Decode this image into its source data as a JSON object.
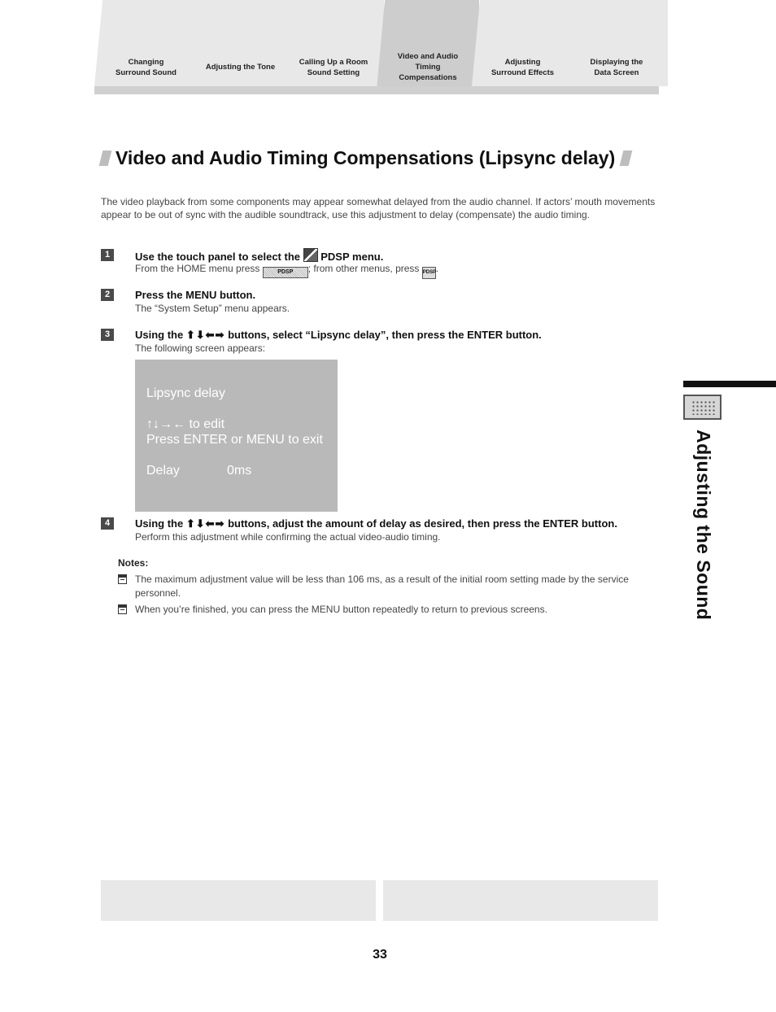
{
  "tabs": [
    {
      "label": "Changing Surround Sound",
      "lines": [
        "Changing",
        "Surround Sound"
      ],
      "active": false
    },
    {
      "label": "Adjusting the Tone",
      "lines": [
        "Adjusting the Tone"
      ],
      "active": false
    },
    {
      "label": "Calling Up a Room Sound Setting",
      "lines": [
        "Calling Up a Room",
        "Sound Setting"
      ],
      "active": false
    },
    {
      "label": "Video and Audio Timing Compensations",
      "lines": [
        "Video and Audio",
        "Timing",
        "Compensations"
      ],
      "active": true
    },
    {
      "label": "Adjusting Surround Effects",
      "lines": [
        "Adjusting",
        "Surround Effects"
      ],
      "active": false
    },
    {
      "label": "Displaying the Data Screen",
      "lines": [
        "Displaying the",
        "Data Screen"
      ],
      "active": false
    }
  ],
  "title": "Video and Audio Timing Compensations (Lipsync delay)",
  "intro": "The video playback from some components may appear somewhat delayed from the audio channel. If actors’ mouth movements appear to be out of sync with the audible soundtrack, use this adjustment to delay (compensate) the audio timing.",
  "steps": [
    {
      "number": "1",
      "head_pre": "Use the touch panel to select the",
      "head_icon": "pdsp-menu-icon",
      "head_post": "PDSP menu.",
      "sub_pre": "From the HOME menu press",
      "sub_key_wide": "PDSP",
      "sub_mid": "; from other menus, press",
      "sub_key_small": "PDSP",
      "sub_post": "."
    },
    {
      "number": "2",
      "head": "Press the MENU button.",
      "sub": "The “System Setup” menu appears."
    },
    {
      "number": "3",
      "head_pre": "Using the",
      "arrows": "⬆⬇⬅➡",
      "head_post": "buttons, select “Lipsync delay”, then press the ENTER button.",
      "sub": "The following screen appears:"
    },
    {
      "number": "4",
      "head_pre": "Using the",
      "arrows": "⬆⬇⬅➡",
      "head_post": "buttons, adjust the amount of delay as desired, then press the ENTER button.",
      "sub": "Perform this adjustment while confirming the actual video-audio timing."
    }
  ],
  "screen": {
    "title": "Lipsync delay",
    "edit_hint": "↑↓→← to edit",
    "exit_hint": "Press ENTER or MENU to exit",
    "delay_label": "Delay",
    "delay_value": "0ms"
  },
  "notes": {
    "heading": "Notes:",
    "items": [
      "The maximum adjustment value will be less than 106 ms, as a result of the initial room setting made by the service personnel.",
      "When you’re finished, you can press the MENU button repeatedly to return to previous screens."
    ]
  },
  "side_tab": {
    "icon": "speaker-grid-icon",
    "title": "Adjusting the Sound"
  },
  "page_number": "33"
}
